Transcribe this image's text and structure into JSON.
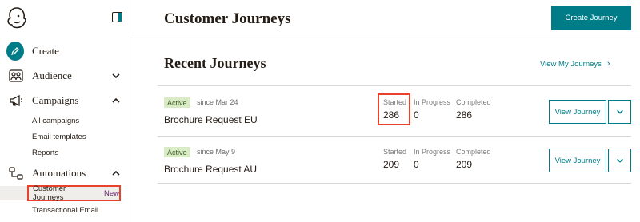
{
  "sidebar": {
    "create_label": "Create",
    "audience_label": "Audience",
    "campaigns_label": "Campaigns",
    "campaigns_items": [
      "All campaigns",
      "Email templates",
      "Reports"
    ],
    "automations_label": "Automations",
    "automations_items": {
      "customer_journeys": "Customer Journeys",
      "new_badge": "New",
      "transactional": "Transactional Email"
    }
  },
  "header": {
    "title": "Customer Journeys",
    "create_button": "Create Journey"
  },
  "recent": {
    "title": "Recent Journeys",
    "view_all": "View My Journeys",
    "stat_labels": {
      "started": "Started",
      "in_progress": "In Progress",
      "completed": "Completed"
    },
    "view_button": "View Journey",
    "journeys": [
      {
        "status": "Active",
        "since": "since Mar 24",
        "name": "Brochure Request EU",
        "started": "286",
        "in_progress": "0",
        "completed": "286"
      },
      {
        "status": "Active",
        "since": "since May 9",
        "name": "Brochure Request AU",
        "started": "209",
        "in_progress": "0",
        "completed": "209"
      }
    ]
  },
  "colors": {
    "accent": "#007c89",
    "highlight": "#e8412c",
    "badge_bg": "#d9ebc5"
  }
}
